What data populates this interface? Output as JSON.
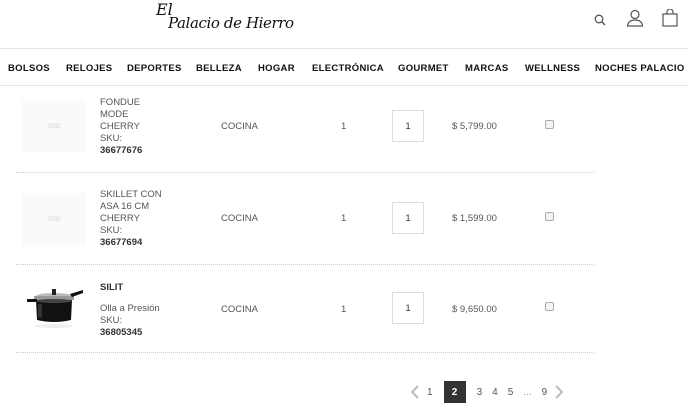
{
  "header": {
    "logo_prefix": "El",
    "logo_name": "Palacio de Hierro",
    "icons": [
      "search-icon",
      "user-icon",
      "shopping-bag-icon"
    ]
  },
  "nav": {
    "items": [
      "BOLSOS",
      "RELOJES",
      "DEPORTES",
      "BELLEZA",
      "HOGAR",
      "ELECTRÓNICA",
      "GOURMET",
      "MARCAS",
      "WELLNESS",
      "NOCHES PALACIO"
    ]
  },
  "products": [
    {
      "thumb_text": "Silit",
      "name": "FONDUE MODE CHERRY",
      "sku_label": "SKU:",
      "sku": "36677676",
      "category": "COCINA",
      "count": "1",
      "quantity": "1",
      "price": "$ 5,799.00"
    },
    {
      "thumb_text": "Silit",
      "name": "SKILLET CON ASA 16 CM CHERRY",
      "sku_label": "SKU:",
      "sku": "36677694",
      "category": "COCINA",
      "count": "1",
      "quantity": "1",
      "price": "$ 1,599.00"
    },
    {
      "brand": "SILIT",
      "name": "Olla a Presión",
      "sku_label": "SKU:",
      "sku": "36805345",
      "category": "COCINA",
      "count": "1",
      "quantity": "1",
      "price": "$ 9,650.00"
    }
  ],
  "pagination": {
    "pages": [
      "1",
      "2",
      "3",
      "4",
      "5",
      "...",
      "9"
    ],
    "current": "2"
  }
}
